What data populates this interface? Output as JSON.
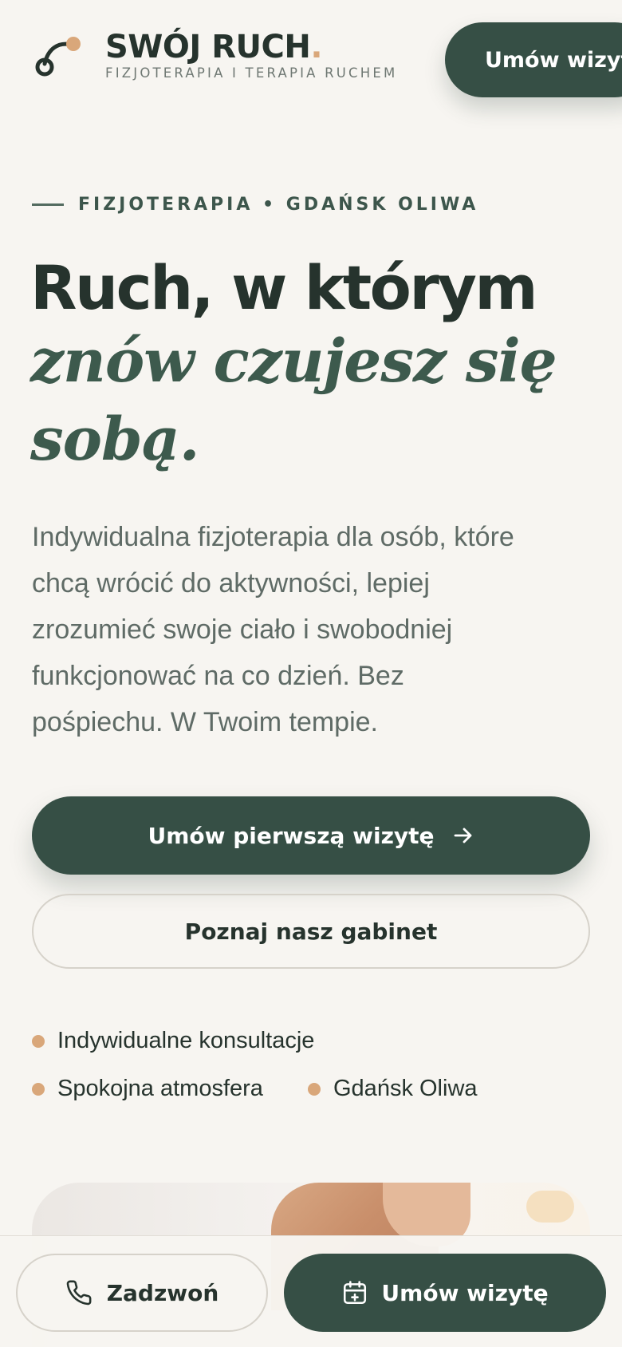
{
  "header": {
    "brand_name": "SWÓJ RUCH",
    "brand_dot": ".",
    "tagline": "FIZJOTERAPIA I TERAPIA RUCHEM",
    "cta_label": "Umów wizytę"
  },
  "hero": {
    "eyebrow": "FIZJOTERAPIA • GDAŃSK OLIWA",
    "headline_line1": "Ruch, w którym",
    "headline_line2": "znów czujesz się",
    "headline_line3": "sobą.",
    "lead_lines": [
      "Indywidualna fizjoterapia dla osób, które",
      "chcą wrócić do aktywności, lepiej",
      "zrozumieć swoje ciało i swobodniej",
      "funkcjonować na co dzień. Bez",
      "pośpiechu. W Twoim tempie."
    ],
    "primary_cta": "Umów pierwszą wizytę",
    "secondary_cta": "Poznaj nasz gabinet"
  },
  "features": [
    "Indywidualne konsultacje",
    "Spokojna atmosfera",
    "Gdańsk Oliwa"
  ],
  "bottom_bar": {
    "call_label": "Zadzwoń",
    "book_label": "Umów wizytę"
  },
  "icons": {
    "logo": "logo-mark-icon",
    "arrow": "arrow-right-icon",
    "phone": "phone-icon",
    "calendar": "calendar-plus-icon"
  },
  "colors": {
    "background": "#f7f5f1",
    "primary": "#364f45",
    "accent": "#d9a77a",
    "text": "#26332d"
  }
}
